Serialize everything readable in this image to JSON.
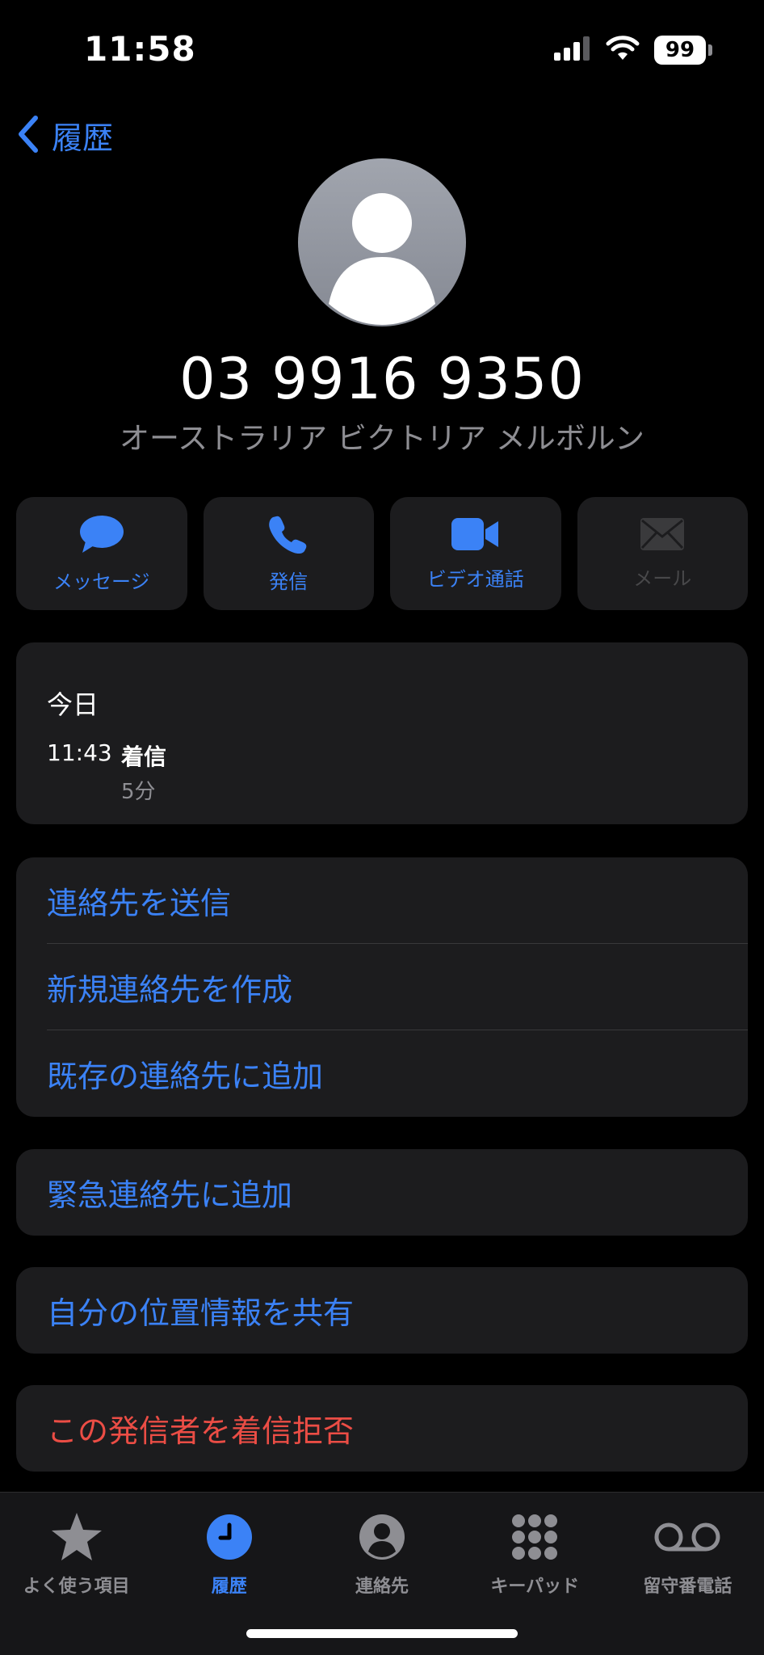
{
  "status_bar": {
    "time": "11:58",
    "battery_level": "99",
    "icons": [
      "signal-icon",
      "wifi-icon",
      "battery-icon"
    ]
  },
  "nav": {
    "back_label": "履歴",
    "back_icon": "chevron-left-icon"
  },
  "contact": {
    "phone_number": "03 9916 9350",
    "location": "オーストラリア ビクトリア メルボルン",
    "avatar_icon": "person-silhouette-icon"
  },
  "actions": [
    {
      "label": "メッセージ",
      "icon": "message-bubble-icon",
      "enabled": true
    },
    {
      "label": "発信",
      "icon": "phone-icon",
      "enabled": true
    },
    {
      "label": "ビデオ通話",
      "icon": "video-camera-icon",
      "enabled": true
    },
    {
      "label": "メール",
      "icon": "envelope-icon",
      "enabled": false
    }
  ],
  "call_history": {
    "day": "今日",
    "entries": [
      {
        "time": "11:43",
        "type": "着信",
        "duration": "5分"
      }
    ]
  },
  "options": {
    "group1": [
      "連絡先を送信",
      "新規連絡先を作成",
      "既存の連絡先に追加"
    ],
    "emergency": "緊急連絡先に追加",
    "share_location": "自分の位置情報を共有",
    "block": "この発信者を着信拒否"
  },
  "tab_bar": {
    "tabs": [
      {
        "label": "よく使う項目",
        "icon": "star-icon",
        "active": false
      },
      {
        "label": "履歴",
        "icon": "clock-icon",
        "active": true
      },
      {
        "label": "連絡先",
        "icon": "person-circle-icon",
        "active": false
      },
      {
        "label": "キーパッド",
        "icon": "keypad-icon",
        "active": false
      },
      {
        "label": "留守番電話",
        "icon": "voicemail-icon",
        "active": false
      }
    ]
  },
  "colors": {
    "accent": "#3b82f6",
    "danger": "#eb4d45",
    "card": "#1c1c1e",
    "secondary_text": "#8e8e93"
  }
}
